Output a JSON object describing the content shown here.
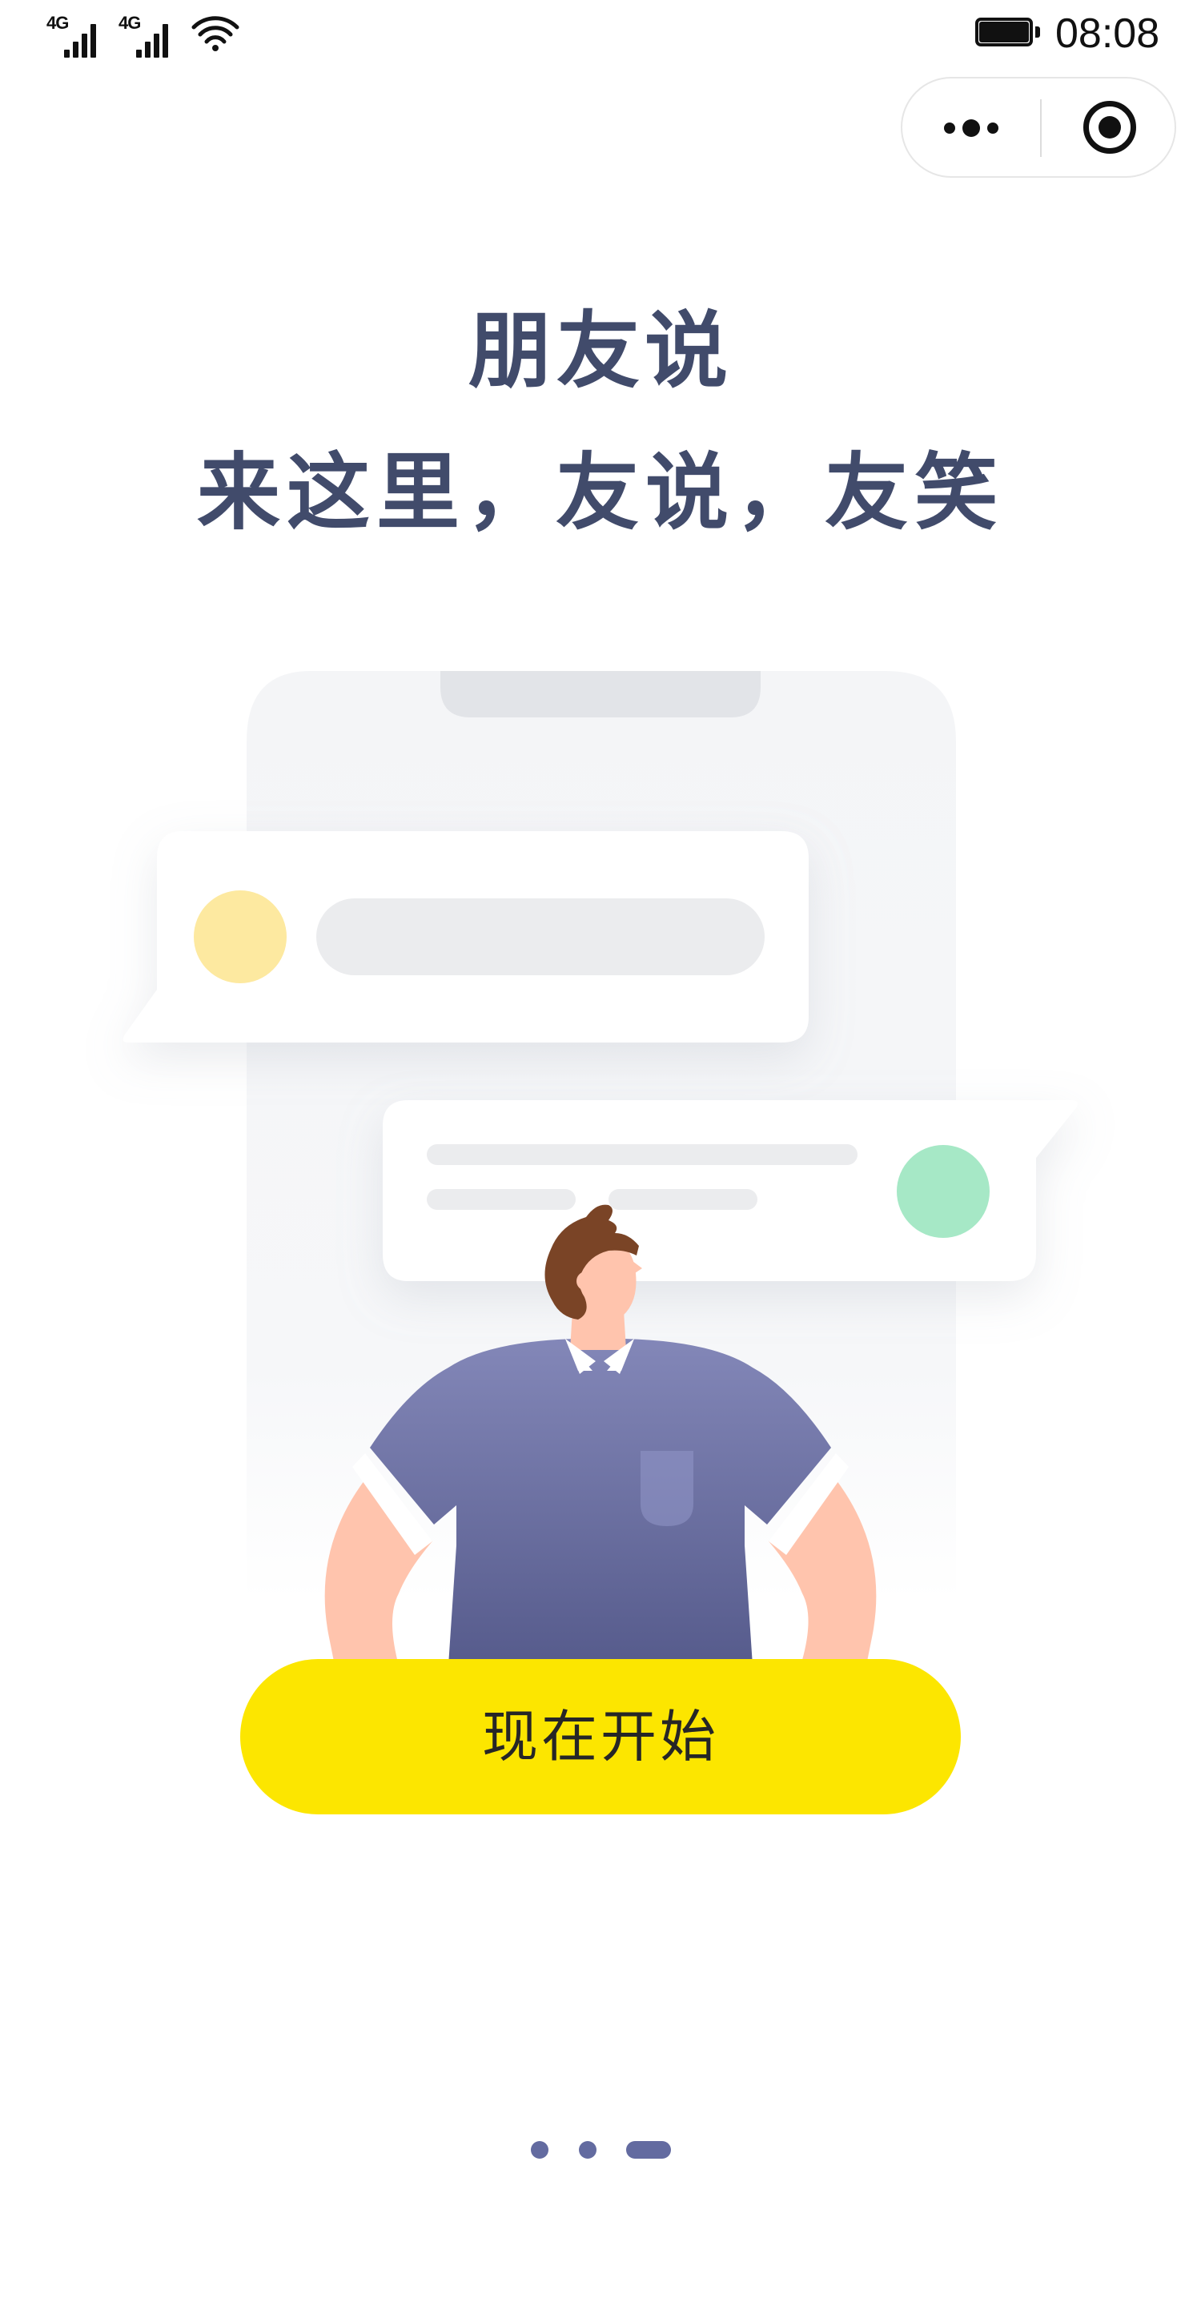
{
  "status_bar": {
    "signal_1_label": "4G",
    "signal_2_label": "4G",
    "wifi_icon": "wifi-icon",
    "battery_icon": "battery-full-icon",
    "time": "08:08"
  },
  "capsule": {
    "more_icon": "more-dots-icon",
    "close_icon": "target-close-icon"
  },
  "headline": {
    "line1": "朋友说",
    "line2": "来这里，友说，友笑"
  },
  "start_button": {
    "label": "现在开始"
  },
  "pagination": {
    "total": 3,
    "active_index": 2
  },
  "colors": {
    "headline": "#414b6b",
    "button": "#fce600",
    "button_text": "#262626",
    "pager": "#636ba0",
    "avatar_yellow": "#fde9a0",
    "avatar_green": "#a6e8c6",
    "shirt": "#7b80b2",
    "skin": "#ffc4ad",
    "hair": "#7a4426"
  }
}
